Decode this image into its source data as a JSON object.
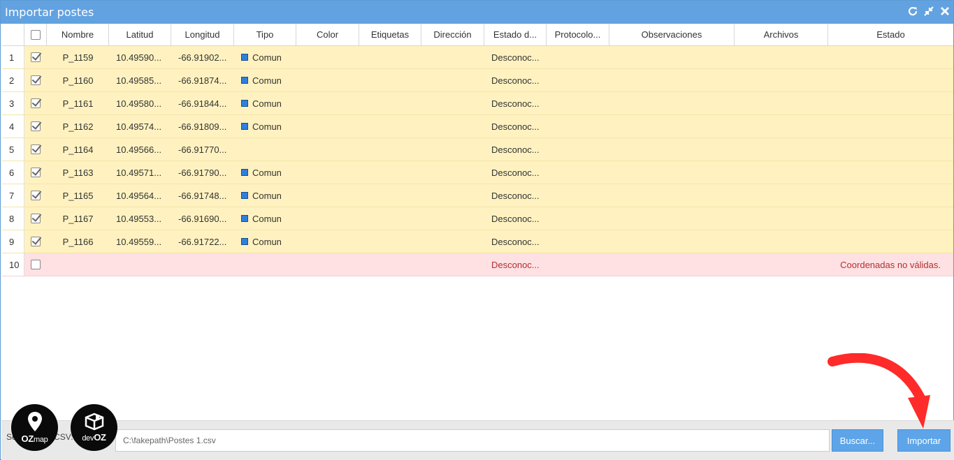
{
  "window": {
    "title": "Importar postes"
  },
  "toolbar": {
    "refresh_icon": "refresh-icon",
    "collapse_icon": "collapse-icon",
    "close_icon": "close-icon"
  },
  "columns": [
    "",
    "",
    "Nombre",
    "Latitud",
    "Longitud",
    "Tipo",
    "Color",
    "Etiquetas",
    "Dirección",
    "Estado d...",
    "Protocolo...",
    "Observaciones",
    "Archivos",
    "Estado"
  ],
  "rows": [
    {
      "num": "1",
      "checked": true,
      "nombre": "P_1159",
      "latitud": "10.49590...",
      "longitud": "-66.91902...",
      "tipo": "Comun",
      "estado_d": "Desconoc...",
      "estado": "",
      "invalid": false
    },
    {
      "num": "2",
      "checked": true,
      "nombre": "P_1160",
      "latitud": "10.49585...",
      "longitud": "-66.91874...",
      "tipo": "Comun",
      "estado_d": "Desconoc...",
      "estado": "",
      "invalid": false
    },
    {
      "num": "3",
      "checked": true,
      "nombre": "P_1161",
      "latitud": "10.49580...",
      "longitud": "-66.91844...",
      "tipo": "Comun",
      "estado_d": "Desconoc...",
      "estado": "",
      "invalid": false
    },
    {
      "num": "4",
      "checked": true,
      "nombre": "P_1162",
      "latitud": "10.49574...",
      "longitud": "-66.91809...",
      "tipo": "Comun",
      "estado_d": "Desconoc...",
      "estado": "",
      "invalid": false
    },
    {
      "num": "5",
      "checked": true,
      "nombre": "P_1164",
      "latitud": "10.49566...",
      "longitud": "-66.91770...",
      "tipo": "",
      "estado_d": "Desconoc...",
      "estado": "",
      "invalid": false
    },
    {
      "num": "6",
      "checked": true,
      "nombre": "P_1163",
      "latitud": "10.49571...",
      "longitud": "-66.91790...",
      "tipo": "Comun",
      "estado_d": "Desconoc...",
      "estado": "",
      "invalid": false
    },
    {
      "num": "7",
      "checked": true,
      "nombre": "P_1165",
      "latitud": "10.49564...",
      "longitud": "-66.91748...",
      "tipo": "Comun",
      "estado_d": "Desconoc...",
      "estado": "",
      "invalid": false
    },
    {
      "num": "8",
      "checked": true,
      "nombre": "P_1167",
      "latitud": "10.49553...",
      "longitud": "-66.91690...",
      "tipo": "Comun",
      "estado_d": "Desconoc...",
      "estado": "",
      "invalid": false
    },
    {
      "num": "9",
      "checked": true,
      "nombre": "P_1166",
      "latitud": "10.49559...",
      "longitud": "-66.91722...",
      "tipo": "Comun",
      "estado_d": "Desconoc...",
      "estado": "",
      "invalid": false
    },
    {
      "num": "10",
      "checked": false,
      "nombre": "",
      "latitud": "",
      "longitud": "",
      "tipo": "",
      "estado_d": "Desconoc...",
      "estado": "Coordenadas no válidas.",
      "invalid": true
    }
  ],
  "footer": {
    "label": "Se... un ar... CSV:",
    "file_path": "C:\\fakepath\\Postes 1.csv",
    "buscar_label": "Buscar...",
    "importar_label": "Importar"
  },
  "logos": {
    "ozmap": {
      "text_bold": "OZ",
      "text_small": "map"
    },
    "devoz": {
      "text_small": "dev",
      "text_bold": "OZ"
    }
  },
  "colors": {
    "titlebar": "#62a2e0",
    "row_valid": "#fff2c0",
    "row_invalid": "#ffe0e3",
    "button": "#5da5e8",
    "arrow": "#ff2a2a",
    "error_text": "#b0312f"
  }
}
